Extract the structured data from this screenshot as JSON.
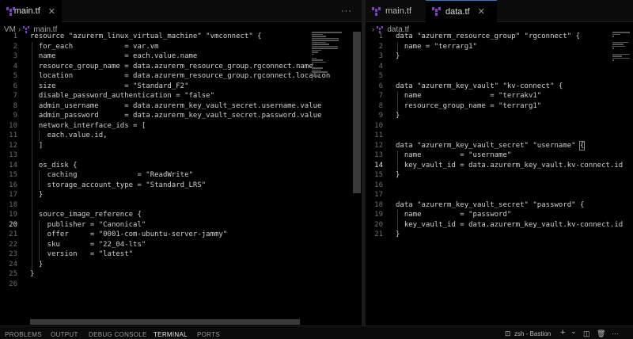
{
  "left": {
    "tab": {
      "label": "main.tf",
      "close": "✕"
    },
    "more": "···",
    "breadcrumb": {
      "folder": "VM",
      "file": "main.tf"
    },
    "current_line": 20,
    "lines": [
      "resource \"azurerm_linux_virtual_machine\" \"vmconnect\" {",
      "  for_each            = var.vm",
      "  name                = each.value.name",
      "  resource_group_name = data.azurerm_resource_group.rgconnect.name",
      "  location            = data.azurerm_resource_group.rgconnect.location",
      "  size                = \"Standard_F2\"",
      "  disable_password_authentication = \"false\"",
      "  admin_username      = data.azurerm_key_vault_secret.username.value",
      "  admin_password      = data.azurerm_key_vault_secret.password.value",
      "  network_interface_ids = [",
      "    each.value.id,",
      "  ]",
      "",
      "  os_disk {",
      "    caching              = \"ReadWrite\"",
      "    storage_account_type = \"Standard_LRS\"",
      "  }",
      "",
      "  source_image_reference {",
      "    publisher = \"Canonical\"",
      "    offer     = \"0001-com-ubuntu-server-jammy\"",
      "    sku       = \"22_04-lts\"",
      "    version   = \"latest\"",
      "  }",
      "}",
      ""
    ]
  },
  "right": {
    "tabs": [
      {
        "label": "main.tf"
      },
      {
        "label": "data.tf",
        "close": "✕"
      }
    ],
    "breadcrumb": {
      "file": "data.tf"
    },
    "current_line": 14,
    "lines": [
      "data \"azurerm_resource_group\" \"rgconnect\" {",
      "  name = \"terrarg1\"",
      "}",
      "",
      "",
      "data \"azurerm_key_vault\" \"kv-connect\" {",
      "  name                = \"terrakv1\"",
      "  resource_group_name = \"terrarg1\"",
      "}",
      "",
      "",
      "data \"azurerm_key_vault_secret\" \"username\" {",
      "  name         = \"username\"",
      "  key_vault_id = data.azurerm_key_vault.kv-connect.id",
      "}",
      "",
      "",
      "data \"azurerm_key_vault_secret\" \"password\" {",
      "  name         = \"password\"",
      "  key_vault_id = data.azurerm_key_vault.kv-connect.id",
      "}"
    ]
  },
  "panel": {
    "tabs": [
      "PROBLEMS",
      "OUTPUT",
      "DEBUG CONSOLE",
      "TERMINAL",
      "PORTS"
    ],
    "active_tab": "TERMINAL",
    "terminal_name": "zsh - Bastion",
    "add": "+",
    "chevron": "⌄",
    "more": "···"
  },
  "colors": {
    "accent": "#3a75c4",
    "terraform": "#7b42bc"
  }
}
